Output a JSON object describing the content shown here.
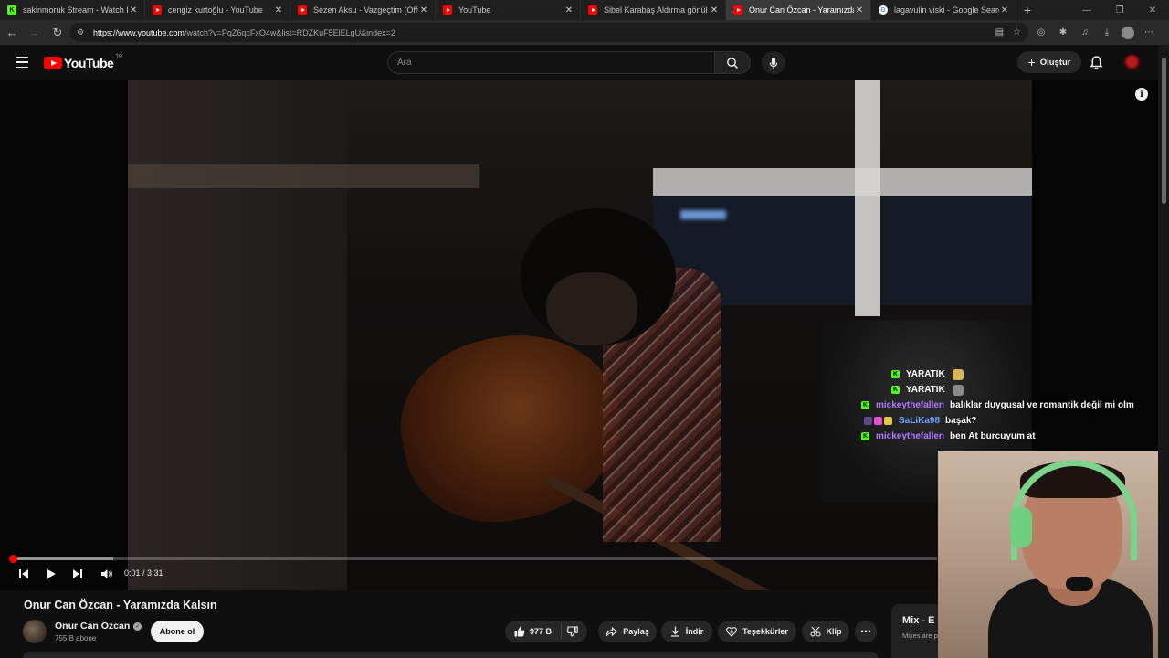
{
  "browser": {
    "tabs": [
      {
        "title": "sakinmoruk Stream - Watch Live on Kick",
        "icon": "kick-icon",
        "active": false
      },
      {
        "title": "cengiz kurtoğlu - YouTube",
        "icon": "youtube-icon",
        "active": false
      },
      {
        "title": "Sezen Aksu - Vazgeçtim (Official Audio)",
        "icon": "youtube-icon",
        "active": false
      },
      {
        "title": "YouTube",
        "icon": "youtube-icon",
        "active": false
      },
      {
        "title": "Sibel Karabaş Aldırma gönül Aldırma",
        "icon": "youtube-icon",
        "active": false
      },
      {
        "title": "Onur Can Özcan - Yaramızda Kalsın",
        "icon": "youtube-icon",
        "active": true
      },
      {
        "title": "lagavulin viski - Google Search",
        "icon": "google-icon",
        "active": false
      }
    ],
    "url_host": "https://www.youtube.com",
    "url_rest": "/watch?v=PqZ6qcFxO4w&list=RDZKuF5ElELgU&index=2"
  },
  "youtube": {
    "logo_text": "YouTube",
    "country_code": "TR",
    "search_placeholder": "Ara",
    "create_label": "Oluştur"
  },
  "player": {
    "time_current": "0:01",
    "time_total": "3:31",
    "time_display": "0:01 / 3:31",
    "played_fraction": 0.005,
    "buffered_fraction": 0.11
  },
  "chat": [
    {
      "badges": [
        "kick"
      ],
      "name": "YARATIK",
      "name_color": "#ffffff",
      "message": "",
      "emote_color": "#d8b45a"
    },
    {
      "badges": [
        "kick"
      ],
      "name": "YARATIK",
      "name_color": "#ffffff",
      "message": "",
      "emote_color": "#8a8a8a"
    },
    {
      "badges": [
        "kick"
      ],
      "name": "mickeythefallen",
      "name_color": "#b07cff",
      "message": "balıklar duygusal ve romantik değil mi olm",
      "emote_color": ""
    },
    {
      "badges": [
        "sub",
        "gift",
        "crown"
      ],
      "name": "SaLiKa98",
      "name_color": "#6ea6ff",
      "message": "başak?",
      "emote_color": ""
    },
    {
      "badges": [
        "kick"
      ],
      "name": "mickeythefallen",
      "name_color": "#b07cff",
      "message": "ben At burcuyum at",
      "emote_color": ""
    }
  ],
  "video": {
    "title": "Onur Can Özcan - Yaramızda Kalsın",
    "channel_name": "Onur Can Özcan",
    "subscribers": "755 B abone",
    "subscribe_label": "Abone ol",
    "like_count": "977 B",
    "share_label": "Paylaş",
    "download_label": "İndir",
    "thanks_label": "Teşekkürler",
    "clip_label": "Klip"
  },
  "sidebar": {
    "mix_title": "Mix - E",
    "mix_sub": "Mixes are p"
  },
  "colors": {
    "accent_red": "#ff0000",
    "kick_green": "#53fc18",
    "background": "#0f0f0f"
  }
}
